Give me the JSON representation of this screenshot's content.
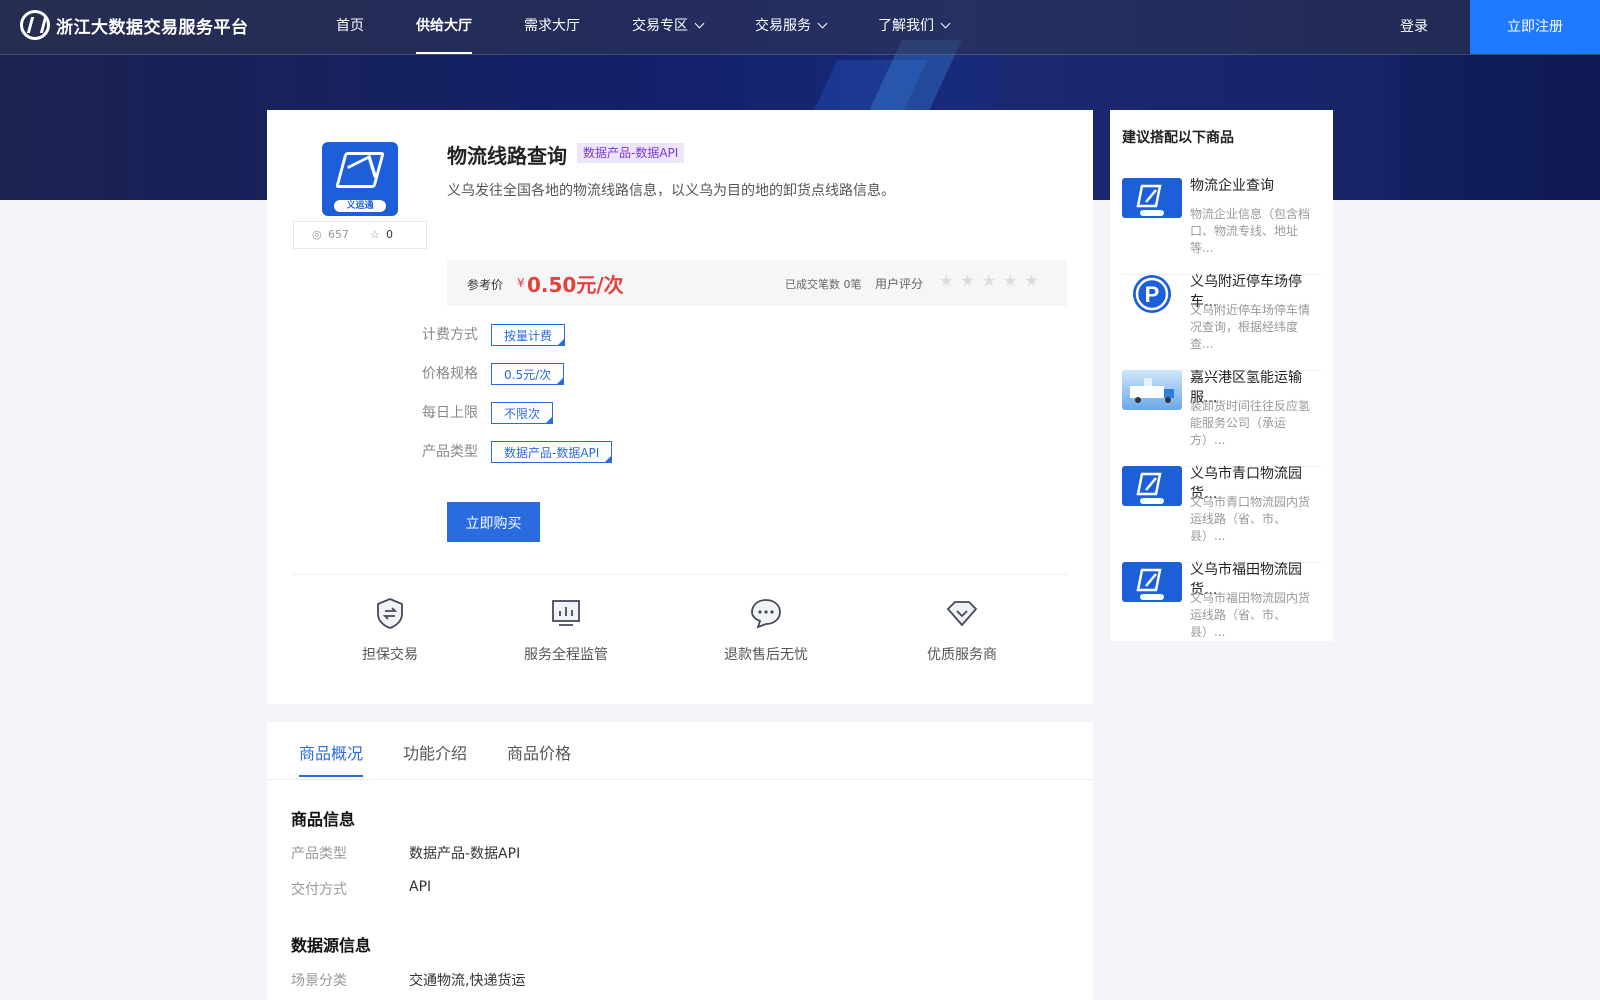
{
  "nav": {
    "brand": "浙江大数据交易服务平台",
    "items": [
      {
        "label": "首页",
        "active": false,
        "dropdown": false
      },
      {
        "label": "供给大厅",
        "active": true,
        "dropdown": false
      },
      {
        "label": "需求大厅",
        "active": false,
        "dropdown": false
      },
      {
        "label": "交易专区",
        "active": false,
        "dropdown": true
      },
      {
        "label": "交易服务",
        "active": false,
        "dropdown": true
      },
      {
        "label": "了解我们",
        "active": false,
        "dropdown": true
      }
    ],
    "login": "登录",
    "register": "立即注册"
  },
  "product": {
    "logo_text": "义运通",
    "views": "657",
    "favorites": "0",
    "title": "物流线路查询",
    "badge": "数据产品-数据API",
    "description": "义乌发往全国各地的物流线路信息，以义乌为目的地的卸货点线路信息。",
    "price_label": "参考价",
    "currency": "¥",
    "price": "0.50元/次",
    "deals": "已成交笔数  0笔",
    "rating_label": "用户评分",
    "stars": "★★★★★",
    "specs": [
      {
        "label": "计费方式",
        "value": "按量计费"
      },
      {
        "label": "价格规格",
        "value": "0.5元/次"
      },
      {
        "label": "每日上限",
        "value": "不限次"
      },
      {
        "label": "产品类型",
        "value": "数据产品-数据API"
      }
    ],
    "buy_label": "立即购买",
    "features": [
      "担保交易",
      "服务全程监管",
      "退款售后无忧",
      "优质服务商"
    ]
  },
  "sidebar": {
    "title": "建议搭配以下商品",
    "items": [
      {
        "name": "物流企业查询",
        "desc": "物流企业信息（包含档口、物流专线、地址等..."
      },
      {
        "name": "义乌附近停车场停车...",
        "desc": "义乌附近停车场停车情况查询，根据经纬度查..."
      },
      {
        "name": "嘉兴港区氢能运输服...",
        "desc": "装卸货时间往往反应氢能服务公司（承运方）..."
      },
      {
        "name": "义乌市青口物流园货...",
        "desc": "义乌市青口物流园内货运线路（省、市、县）..."
      },
      {
        "name": "义乌市福田物流园货...",
        "desc": "义乌市福田物流园内货运线路（省、市、县）..."
      }
    ]
  },
  "details": {
    "tabs": [
      "商品概况",
      "功能介绍",
      "商品价格"
    ],
    "section1_title": "商品信息",
    "section1_rows": [
      {
        "label": "产品类型",
        "value": "数据产品-数据API"
      },
      {
        "label": "交付方式",
        "value": "API"
      }
    ],
    "section2_title": "数据源信息",
    "section2_rows": [
      {
        "label": "场景分类",
        "value": "交通物流,快递货运"
      }
    ]
  }
}
